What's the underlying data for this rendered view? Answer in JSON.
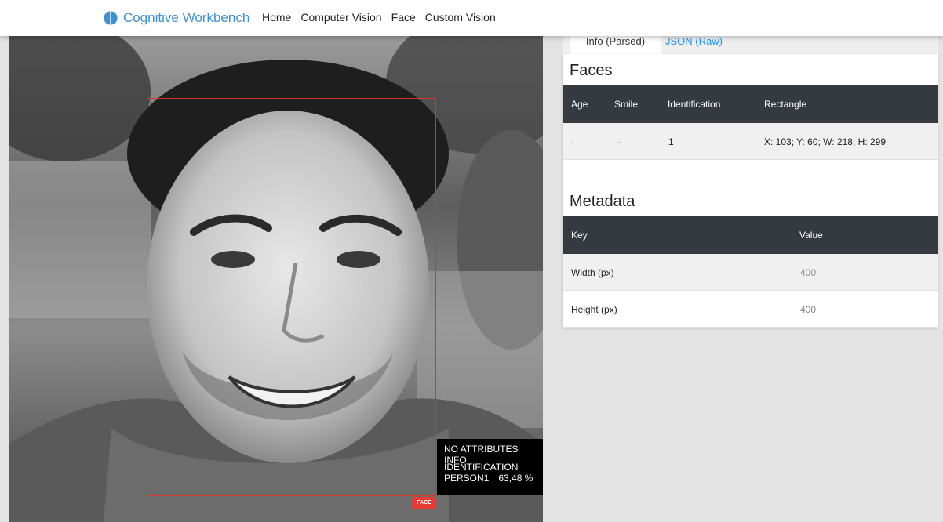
{
  "navbar": {
    "brand": "Cognitive Workbench",
    "links": [
      "Home",
      "Computer Vision",
      "Face",
      "Custom Vision"
    ]
  },
  "photo": {
    "face_tag": "FACE",
    "info_box": {
      "attributes": "NO ATTRIBUTES INFO",
      "identification_label": "IDENTIFICATION",
      "person": "PERSON1",
      "confidence": "63,48 %"
    }
  },
  "tabs": {
    "active": "Info (Parsed)",
    "inactive": "JSON (Raw)"
  },
  "faces": {
    "title": "Faces",
    "headers": [
      "Age",
      "Smile",
      "Identification",
      "Rectangle"
    ],
    "rows": [
      {
        "age": "-",
        "smile": "-",
        "identification": "1",
        "rectangle": "X: 103; Y: 60; W: 218; H: 299"
      }
    ]
  },
  "metadata": {
    "title": "Metadata",
    "headers": [
      "Key",
      "Value"
    ],
    "rows": [
      {
        "key": "Width (px)",
        "value": "400"
      },
      {
        "key": "Height (px)",
        "value": "400"
      }
    ]
  },
  "colors": {
    "brand": "#3f8fd2",
    "table_header": "#343a40",
    "face_box": "#d9362b",
    "link": "#2196f3"
  }
}
